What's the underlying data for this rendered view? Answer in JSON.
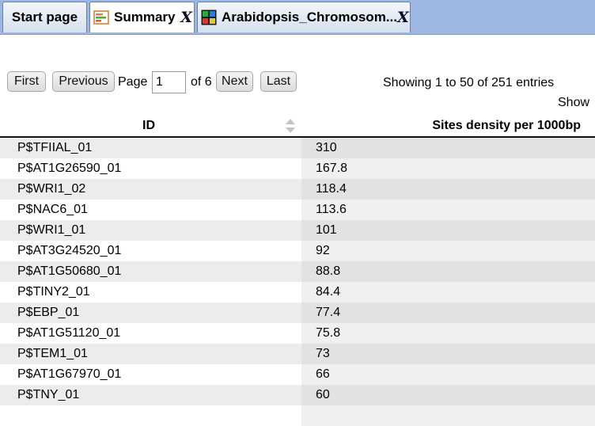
{
  "tabs": [
    {
      "label": "Start page"
    },
    {
      "label": "Summary",
      "close": "X"
    },
    {
      "label": "Arabidopsis_Chromosom...",
      "close": "X"
    }
  ],
  "pager": {
    "first": "First",
    "previous": "Previous",
    "page_label": "Page",
    "page_value": "1",
    "of_text": "of 6",
    "next": "Next",
    "last": "Last",
    "showing": "Showing 1 to 50 of 251 entries",
    "show": "Show"
  },
  "table": {
    "headers": [
      "ID",
      "Sites density per 1000bp"
    ],
    "rows": [
      [
        "P$TFIIAL_01",
        "310"
      ],
      [
        "P$AT1G26590_01",
        "167.8"
      ],
      [
        "P$WRI1_02",
        "118.4"
      ],
      [
        "P$NAC6_01",
        "113.6"
      ],
      [
        "P$WRI1_01",
        "101"
      ],
      [
        "P$AT3G24520_01",
        "92"
      ],
      [
        "P$AT1G50680_01",
        "88.8"
      ],
      [
        "P$TINY2_01",
        "84.4"
      ],
      [
        "P$EBP_01",
        "77.4"
      ],
      [
        "P$AT1G51120_01",
        "75.8"
      ],
      [
        "P$TEM1_01",
        "73"
      ],
      [
        "P$AT1G67970_01",
        "66"
      ],
      [
        "P$TNY_01",
        "60"
      ]
    ]
  },
  "colors": {
    "tabbar_bg": "#9db7e2",
    "row_odd": "#ececec",
    "row_odd_sorted": "#e2e2e2"
  }
}
